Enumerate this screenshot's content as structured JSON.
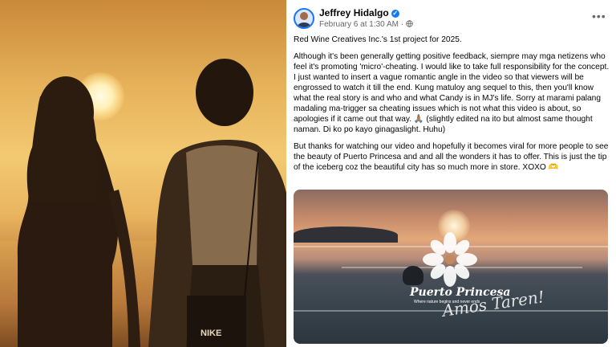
{
  "post": {
    "author": "Jeffrey Hidalgo",
    "timestamp": "February 6 at 1:30 AM",
    "visibility_separator": "·",
    "more_label": "•••",
    "paragraphs": [
      "Red Wine Creatives Inc.'s 1st project for 2025.",
      "Although it's been generally getting positive feedback, siempre may mga netizens who feel it's promoting 'micro'-cheating. I would like to take full responsibility for the concept. I just wanted to insert a vague romantic angle in the video so that viewers will be engrossed to watch it till the end. Kung matuloy ang sequel to this, then you'll know what the real story is and who and what Candy is in MJ's life. Sorry at marami palang madaling ma-trigger sa cheating issues which is not what this video is about, so apologies if it came out that way. 🙏🏽 (slightly edited na ito but almost same thought naman. Di ko po kayo ginagaslight. Huhu)",
      "But thanks for watching our video and hopefully it becomes viral for more people to see the beauty of Puerto Princesa and and all the wonders it has to offer. This is just the tip of the iceberg coz the beautiful city has so much more in store. XOXO 🫶"
    ],
    "media": {
      "logo_title": "Puerto Princesa",
      "logo_tagline": "Where nature begins and never ends",
      "script_text": "Amos Taren!"
    }
  },
  "left_photo": {
    "shirt_brand": "NIKE"
  }
}
